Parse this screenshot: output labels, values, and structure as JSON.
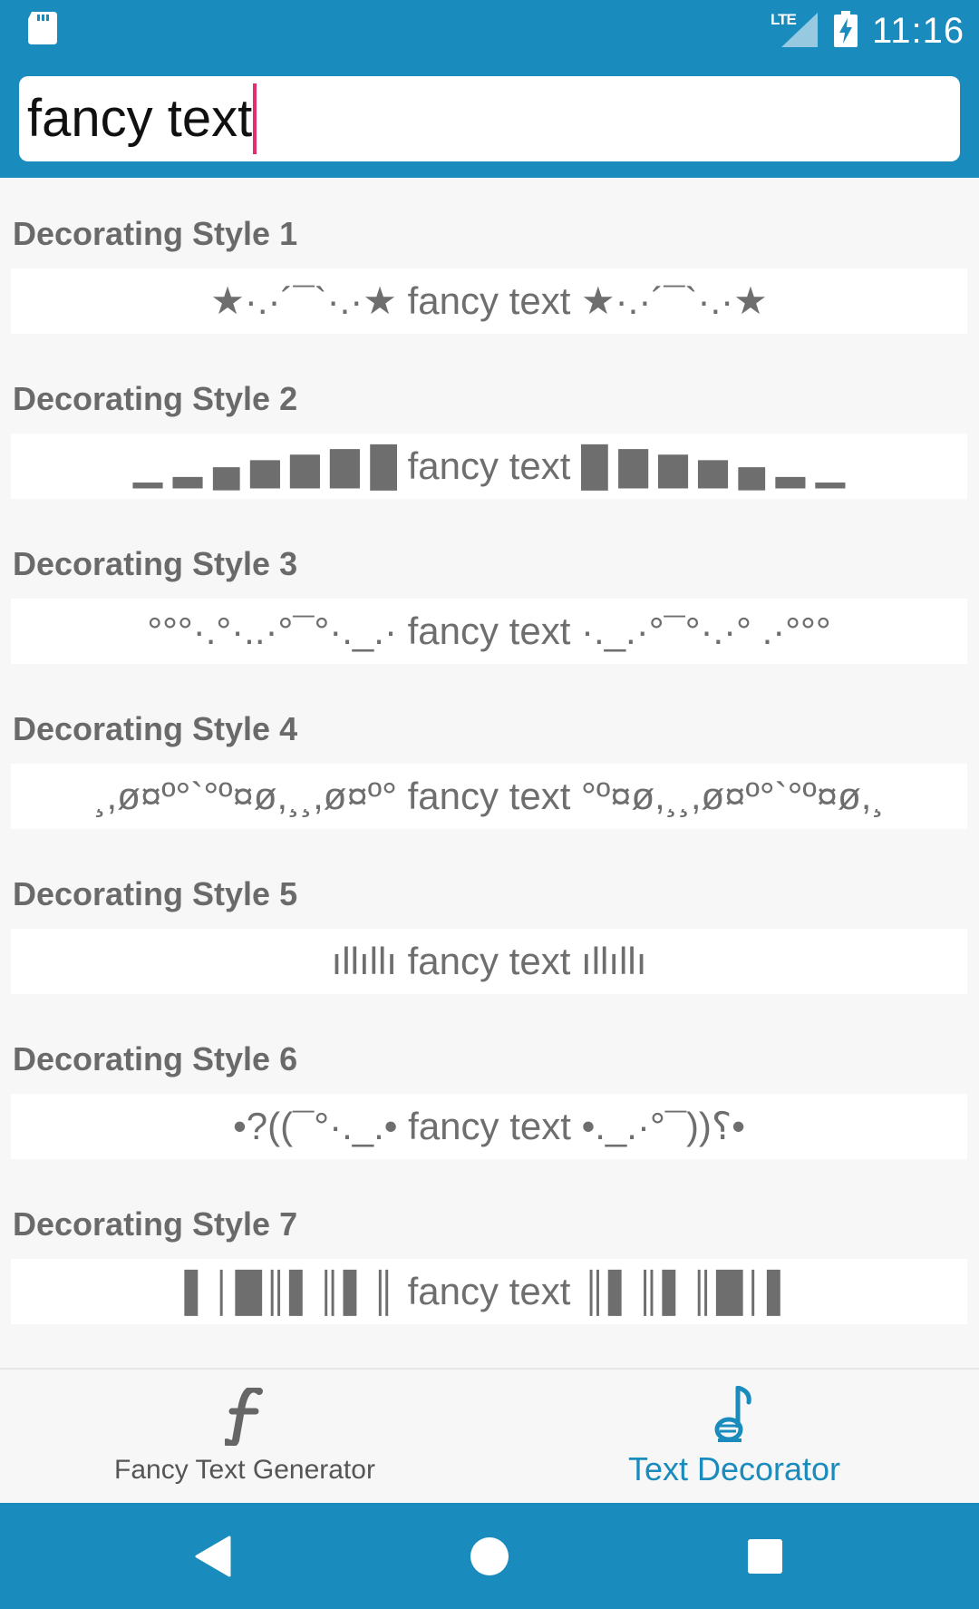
{
  "status_bar": {
    "time": "11:16",
    "network_label": "LTE",
    "icons": [
      "sd-card-icon",
      "lte-signal-icon",
      "battery-charging-icon"
    ],
    "color": "#1a8bbd"
  },
  "search": {
    "value": "fancy text",
    "caret_color": "#e0306f"
  },
  "styles": [
    {
      "title": "Decorating Style 1",
      "text": "★·.·´¯`·.·★ fancy text ★·.·´¯`·.·★"
    },
    {
      "title": "Decorating Style 2",
      "text": "▁ ▂ ▄ ▅ ▆ ▇ █ fancy text █ ▇ ▆ ▅ ▄ ▂ ▁"
    },
    {
      "title": "Decorating Style 3",
      "text": "°°°·.°·..·°¯°·._.· fancy text ·._.·°¯°·.·° .·°°°"
    },
    {
      "title": "Decorating Style 4",
      "text": "¸,ø¤º°`°º¤ø,¸¸,ø¤º° fancy text °º¤ø,¸¸,ø¤º°`°º¤ø,¸"
    },
    {
      "title": "Decorating Style 5",
      "text": "ıllıllı fancy text ıllıllı"
    },
    {
      "title": "Decorating Style 6",
      "text": "•?((¯°·._.• fancy text •._.·°¯))؟•"
    },
    {
      "title": "Decorating Style 7",
      "text": "▌│█║▌║▌║ fancy text ║▌║▌║█│▌"
    }
  ],
  "bottom_nav": {
    "left_label": "Fancy Text Generator",
    "left_icon": "italic-f-icon",
    "right_label": "Text Decorator",
    "right_icon": "music-note-icon",
    "active_color": "#1a8bbd"
  },
  "system_nav": {
    "icons": [
      "back-triangle-icon",
      "home-circle-icon",
      "recents-square-icon"
    ]
  }
}
